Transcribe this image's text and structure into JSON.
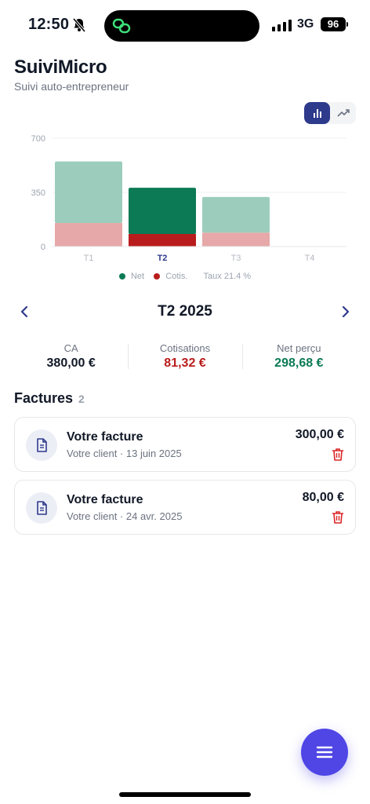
{
  "status_bar": {
    "time": "12:50",
    "network": "3G",
    "battery": "96"
  },
  "header": {
    "title": "SuiviMicro",
    "subtitle": "Suivi auto-entrepreneur"
  },
  "chart_data": {
    "type": "bar",
    "stacked": true,
    "categories": [
      "T1",
      "T2",
      "T3",
      "T4"
    ],
    "active_category": "T2",
    "series": [
      {
        "name": "Cotis.",
        "values": [
          152,
          81.32,
          90,
          0
        ],
        "color": "#b91c1c",
        "faded_color": "#e6a8a8"
      },
      {
        "name": "Net",
        "values": [
          398,
          298.68,
          230,
          0
        ],
        "color": "#0b7a55",
        "faded_color": "#9ccdbc"
      }
    ],
    "yticks": [
      0,
      350,
      700
    ],
    "ylim": [
      0,
      700
    ],
    "grid": true,
    "legend": {
      "net": "Net",
      "cotis": "Cotis.",
      "rate": "Taux 21.4 %"
    }
  },
  "period": {
    "title": "T2 2025"
  },
  "summary": [
    {
      "label": "CA",
      "value": "380,00 €",
      "color": "#111827"
    },
    {
      "label": "Cotisations",
      "value": "81,32 €",
      "color": "#b91c1c"
    },
    {
      "label": "Net perçu",
      "value": "298,68 €",
      "color": "#0b7a55"
    }
  ],
  "invoices": {
    "title": "Factures",
    "count": "2",
    "items": [
      {
        "title": "Votre facture",
        "client": "Votre client · 13 juin 2025",
        "amount": "300,00 €"
      },
      {
        "title": "Votre facture",
        "client": "Votre client · 24 avr. 2025",
        "amount": "80,00 €"
      }
    ]
  },
  "colors": {
    "accent": "#2e3a8c",
    "fab": "#4f46e5",
    "danger": "#dc2626"
  }
}
